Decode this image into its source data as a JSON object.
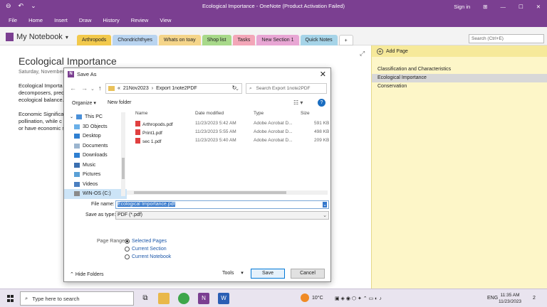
{
  "window": {
    "title": "Ecological Importance - OneNote (Product Activation Failed)",
    "signin": "Sign in"
  },
  "menu": [
    "File",
    "Home",
    "Insert",
    "Draw",
    "History",
    "Review",
    "View"
  ],
  "notebook": {
    "name": "My Notebook",
    "sections": [
      {
        "label": "Arthropods",
        "color": "#f2c94c"
      },
      {
        "label": "Chondrichthyes",
        "color": "#b9d4f0"
      },
      {
        "label": "Whats on toay",
        "color": "#f5d58a"
      },
      {
        "label": "Shop list",
        "color": "#a8d98a"
      },
      {
        "label": "Tasks",
        "color": "#f3a6b8"
      },
      {
        "label": "New Section 1",
        "color": "#e8a6d4"
      },
      {
        "label": "Quick Notes",
        "color": "#a6d4e8"
      }
    ],
    "add_tab": "+",
    "search_placeholder": "Search (Ctrl+E)"
  },
  "page": {
    "title": "Ecological Importance",
    "date": "Saturday, November",
    "text_lines": [
      "Ecological Importa",
      "decomposers, prec",
      "ecological balance.",
      "",
      "Economic Significa",
      "pollination, while c",
      "or have economic s"
    ]
  },
  "pages_panel": {
    "add_page": "Add Page",
    "items": [
      "Classification and Characteristics",
      "Ecological Importance",
      "Conservation"
    ],
    "selected_index": 1
  },
  "dialog": {
    "title": "Save As",
    "address": [
      "«",
      "21Nov2023",
      "›",
      "Export 1note2PDF"
    ],
    "search_placeholder": "Search Export 1note2PDF",
    "organize": "Organize ▾",
    "new_folder": "New folder",
    "help": "?",
    "nav_items": [
      {
        "label": "This PC",
        "icon": "computer-icon"
      },
      {
        "label": "3D Objects",
        "icon": "cube-icon"
      },
      {
        "label": "Desktop",
        "icon": "desktop-icon"
      },
      {
        "label": "Documents",
        "icon": "documents-icon"
      },
      {
        "label": "Downloads",
        "icon": "download-icon"
      },
      {
        "label": "Music",
        "icon": "music-icon"
      },
      {
        "label": "Pictures",
        "icon": "pictures-icon"
      },
      {
        "label": "Videos",
        "icon": "videos-icon"
      },
      {
        "label": "WIN-OS (C:)",
        "icon": "drive-icon"
      }
    ],
    "columns": [
      "Name",
      "Date modified",
      "Type",
      "Size"
    ],
    "files": [
      {
        "name": "Arthropods.pdf",
        "date": "11/23/2023 5:42 AM",
        "type": "Adobe Acrobat D...",
        "size": "591 KB"
      },
      {
        "name": "Print1.pdf",
        "date": "11/23/2023 5:55 AM",
        "type": "Adobe Acrobat D...",
        "size": "498 KB"
      },
      {
        "name": "sec 1.pdf",
        "date": "11/23/2023 5:40 AM",
        "type": "Adobe Acrobat D...",
        "size": "209 KB"
      }
    ],
    "file_name_label": "File name:",
    "file_name_value": "Ecological Importance.pdf",
    "save_type_label": "Save as type:",
    "save_type_value": "PDF (*.pdf)",
    "page_range_label": "Page Range:",
    "ranges": [
      "Selected Pages",
      "Current Section",
      "Current Notebook"
    ],
    "selected_range": 0,
    "hide_folders": "Hide Folders",
    "tools": "Tools",
    "save": "Save",
    "cancel": "Cancel"
  },
  "taskbar": {
    "search_placeholder": "Type here to search",
    "weather": "10°C",
    "lang": "ENG",
    "time": "11:35 AM",
    "date": "11/23/2023",
    "notifications": "2"
  }
}
